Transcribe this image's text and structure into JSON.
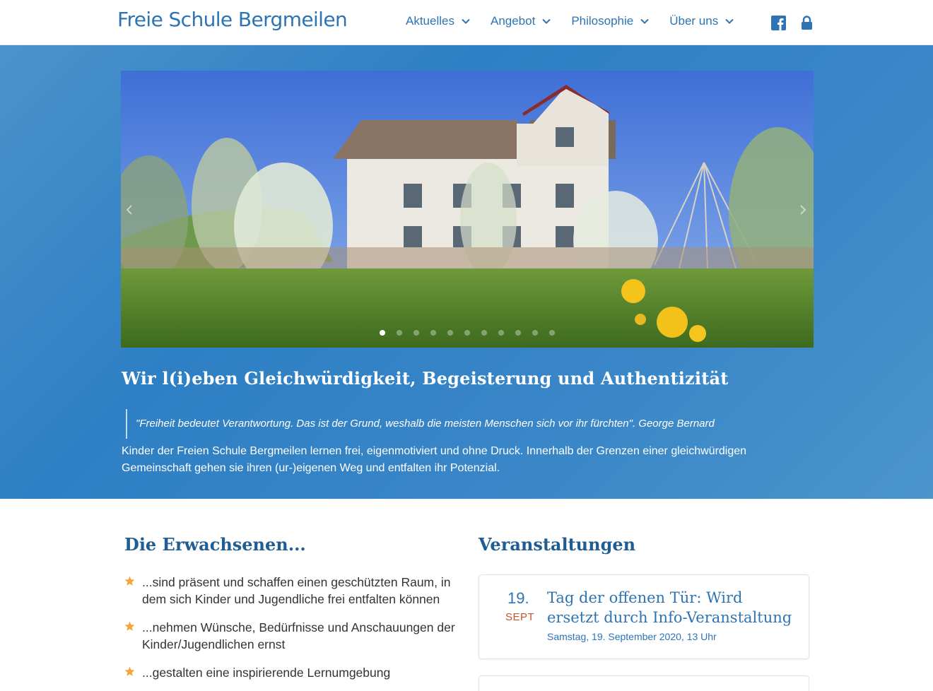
{
  "site": {
    "logo_text": "Freie Schule Bergmeilen",
    "brand_color": "#2d74b4"
  },
  "nav": {
    "items": [
      {
        "label": "Aktuelles"
      },
      {
        "label": "Angebot"
      },
      {
        "label": "Philosophie"
      },
      {
        "label": "Über uns"
      }
    ],
    "icons": [
      "facebook-icon",
      "lock-icon"
    ]
  },
  "slider": {
    "slide_count": 11,
    "active_index": 0,
    "image_description_icon": "school-house-photo"
  },
  "hero": {
    "title": "Wir l(i)eben Gleichwürdigkeit, Begeisterung und Authentizität",
    "quote": "\"Freiheit bedeutet Verantwortung. Das ist der Grund, weshalb die meisten Menschen sich vor ihr fürchten\". George Bernard",
    "text": "Kinder der Freien Schule Bergmeilen lernen frei, eigenmotiviert und ohne Druck. Innerhalb der Grenzen einer gleichwürdigen Gemeinschaft gehen sie ihren (ur-)eigenen Weg und entfalten ihr Potenzial."
  },
  "adults": {
    "title": "Die Erwachsenen...",
    "items": [
      "...sind präsent und schaffen einen geschützten Raum, in dem sich Kinder und Jugendliche frei entfalten können",
      "...nehmen Wünsche, Bedürfnisse und Anschauungen der Kinder/Jugendlichen ernst",
      "...gestalten eine inspirierende Lernumgebung"
    ],
    "bullet_color": "#f0a63a"
  },
  "events": {
    "title": "Veranstaltungen",
    "items": [
      {
        "day": "19.",
        "month": "SEPT",
        "title": "Tag der offenen Tür: Wird ersetzt durch Info-Veranstaltung",
        "date": "Samstag, 19. September 2020,",
        "time": "13 Uhr"
      }
    ]
  }
}
